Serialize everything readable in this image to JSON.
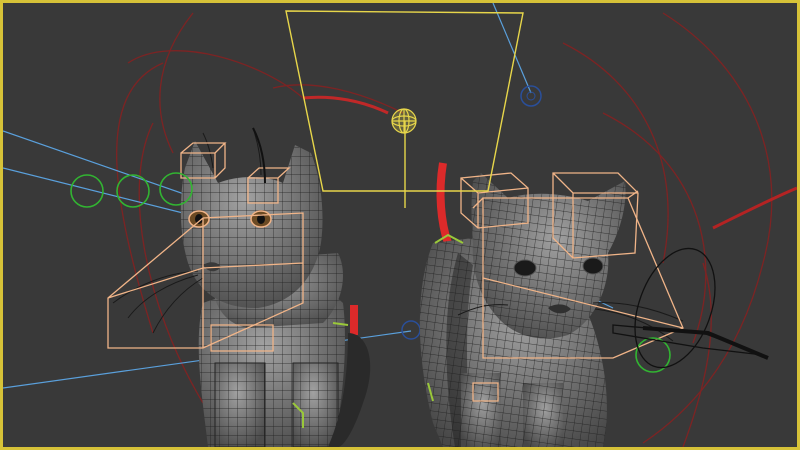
{
  "viewport": {
    "active_border_color": "#d6c238",
    "background_color": "#393939"
  },
  "scene": {
    "objects": [
      {
        "name": "cat-left",
        "type": "mesh-wireframe",
        "shade": "#7d7d7d"
      },
      {
        "name": "cat-right",
        "type": "mesh-wireframe",
        "shade": "#7d7d7d"
      }
    ],
    "selected_objects": [
      "camera-frustum",
      "light-gizmo"
    ],
    "colors": {
      "mesh_line": "#1e1e1e",
      "bone_box": "#f0b488",
      "camera": "#e7d64a",
      "target_line": "#5aa0dc",
      "helper_green": "#32b432",
      "spline_red": "#b42323",
      "bone_red": "#dc2a2a",
      "spline_black": "#111111"
    },
    "icons": [
      "camera-frustum-icon",
      "omni-light-icon",
      "target-helper-icon",
      "control-circle-icon"
    ]
  }
}
